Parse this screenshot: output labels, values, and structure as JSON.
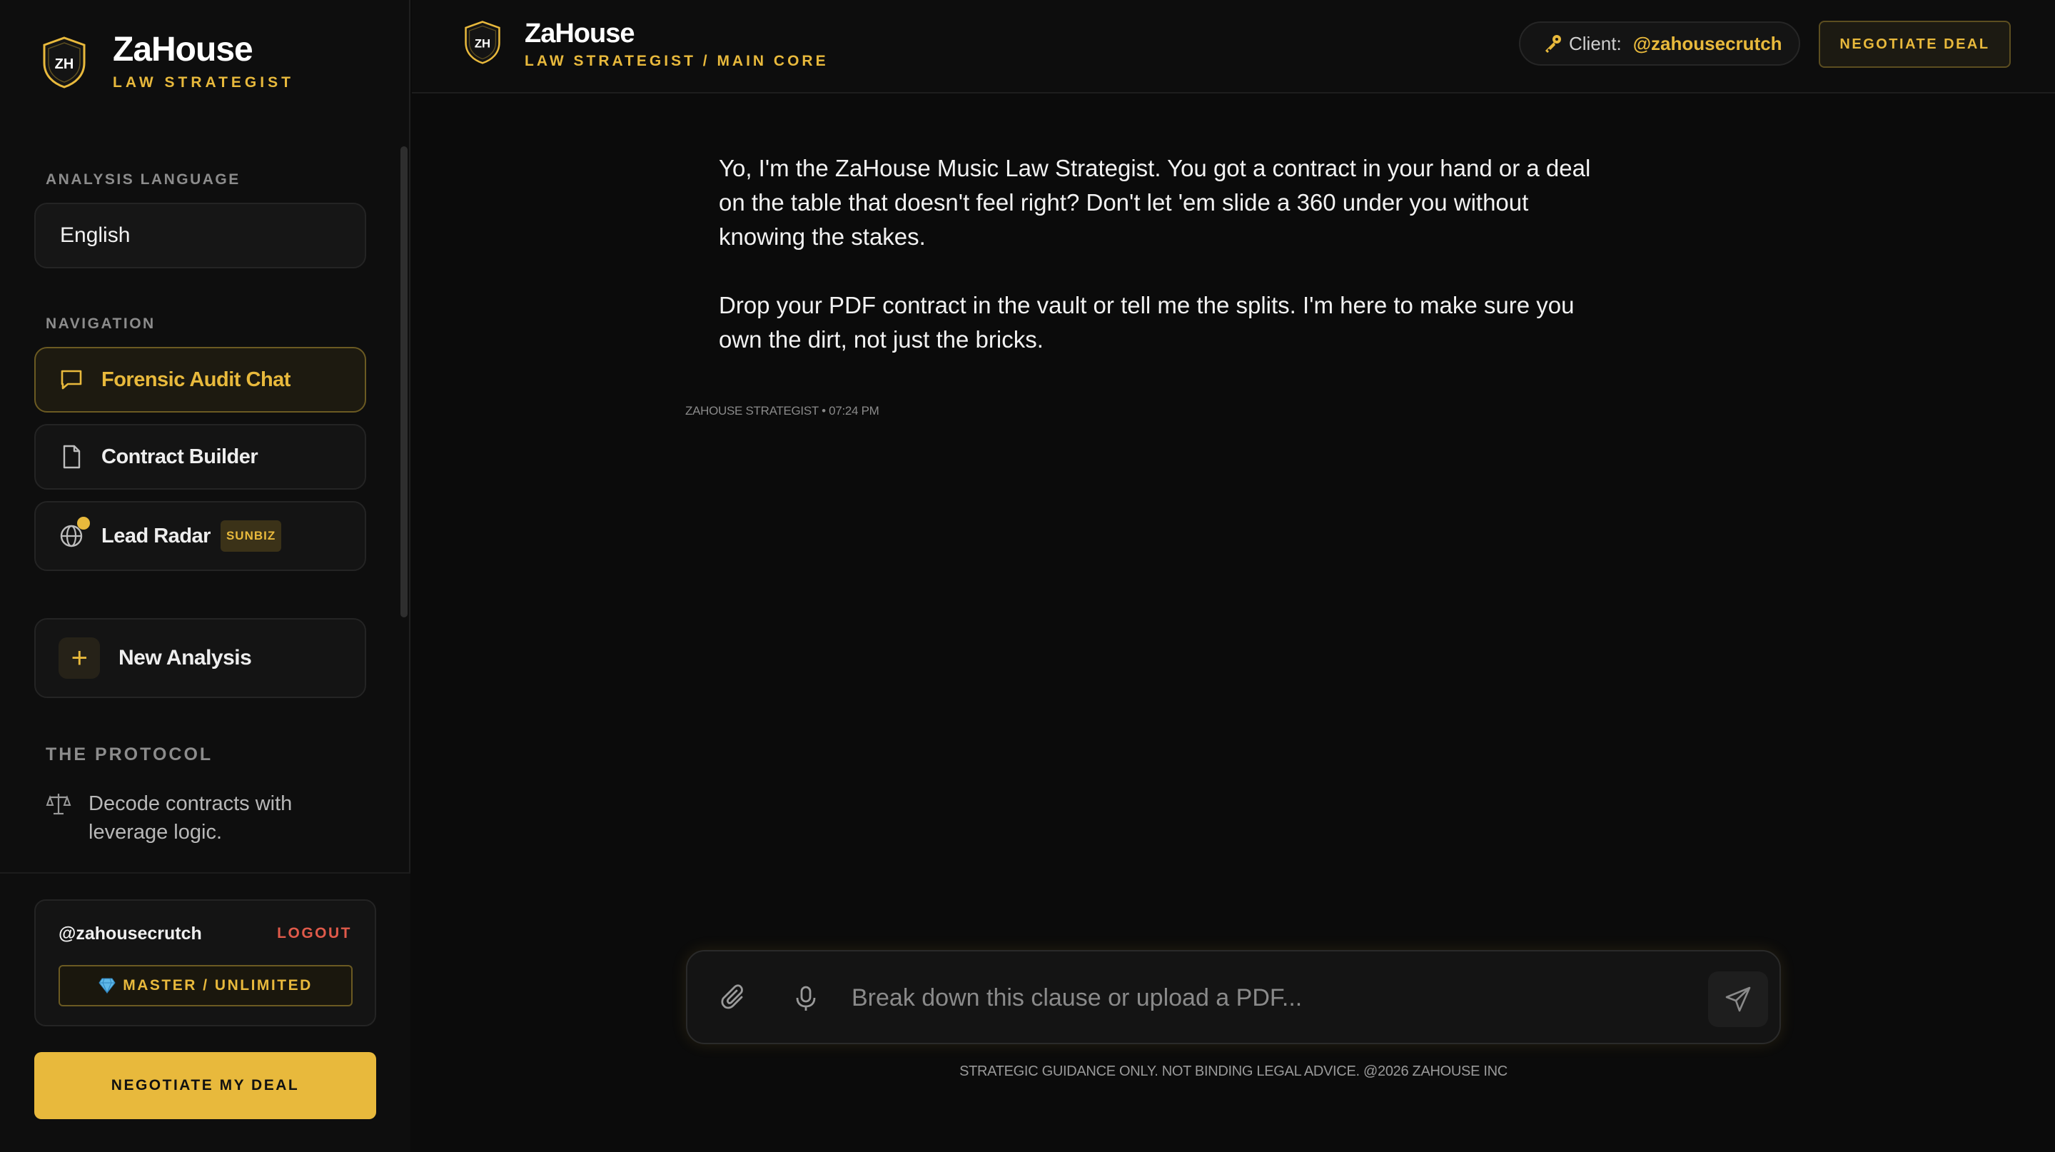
{
  "sidebar": {
    "brand": {
      "name": "ZaHouse",
      "subtitle": "LAW STRATEGIST",
      "logo_text": "ZH"
    },
    "language": {
      "label": "ANALYSIS LANGUAGE",
      "value": "English"
    },
    "navigation": {
      "label": "NAVIGATION",
      "items": [
        {
          "label": "Forensic Audit Chat",
          "icon": "chat-bubble-icon",
          "active": true
        },
        {
          "label": "Contract Builder",
          "icon": "document-icon",
          "active": false
        },
        {
          "label": "Lead Radar",
          "icon": "globe-icon",
          "active": false,
          "badge": "SUNBIZ"
        }
      ]
    },
    "new_analysis": {
      "label": "New Analysis",
      "icon": "+"
    },
    "protocol": {
      "label": "THE PROTOCOL",
      "items": [
        {
          "text": "Decode contracts with leverage logic.",
          "icon": "scale-icon"
        }
      ]
    },
    "user": {
      "handle": "@zahousecrutch",
      "logout": "LOGOUT",
      "tier": "MASTER / UNLIMITED"
    },
    "cta": "NEGOTIATE MY DEAL"
  },
  "topbar": {
    "name": "ZaHouse",
    "subtitle": "LAW STRATEGIST / MAIN CORE",
    "logo_text": "ZH",
    "client_label": "Client:",
    "client_value": "@zahousecrutch",
    "action": "NEGOTIATE DEAL"
  },
  "chat": {
    "messages": [
      {
        "paragraphs": [
          "Yo, I'm the ZaHouse Music Law Strategist. You got a contract in your hand or a deal on the table that doesn't feel right? Don't let 'em slide a 360 under you without knowing the stakes.",
          "Drop your PDF contract in the vault or tell me the splits. I'm here to make sure you own the dirt, not just the bricks."
        ],
        "meta": "ZAHOUSE STRATEGIST • 07:24 PM"
      }
    ]
  },
  "composer": {
    "placeholder": "Break down this clause or upload a PDF..."
  },
  "footer": {
    "disclaimer": "STRATEGIC GUIDANCE ONLY. NOT BINDING LEGAL ADVICE. @2026 ZAHOUSE INC"
  },
  "colors": {
    "accent": "#e8b93c",
    "background": "#0b0b0b",
    "logout": "#e05a4a"
  }
}
